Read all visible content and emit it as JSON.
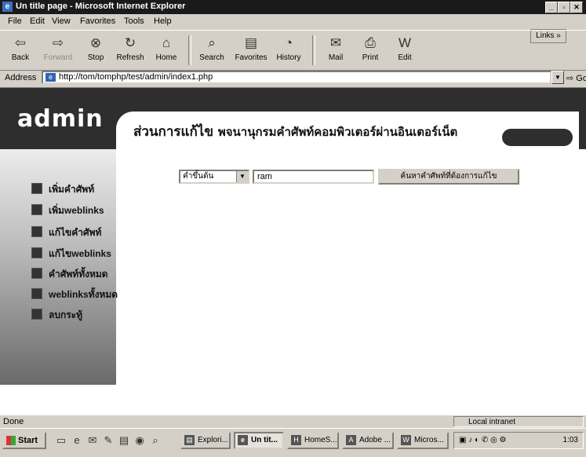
{
  "window": {
    "title": "Un title page - Microsoft Internet Explorer"
  },
  "menu": [
    "File",
    "Edit",
    "View",
    "Favorites",
    "Tools",
    "Help"
  ],
  "links_label": "Links »",
  "toolbar": {
    "back": "Back",
    "forward": "Forward",
    "stop": "Stop",
    "refresh": "Refresh",
    "home": "Home",
    "search": "Search",
    "favorites": "Favorites",
    "history": "History",
    "mail": "Mail",
    "print": "Print",
    "edit": "Edit"
  },
  "address": {
    "label": "Address",
    "url": "http://tom/tomphp/test/admin/index1.php",
    "go": "Go"
  },
  "page": {
    "brand": "admin",
    "heading_part1": "ส่วนการแก้ไข",
    "heading_part2": "พจนานุกรมคำศัพท์คอมพิวเตอร์ผ่านอินเตอร์เน็ต",
    "nav": [
      "เพิ่มคำศัพท์",
      "เพิ่มweblinks",
      "แก้ไขคำศัพท์",
      "แก้ไขweblinks",
      "คำศัพท์ทั้งหมด",
      "weblinksทั้งหมด",
      "ลบกระทู้"
    ],
    "search": {
      "select_value": "คำขึ้นต้น",
      "input_value": "ram",
      "button": "ค้นหาคำศัพท์ที่ต้องการแก้ไข"
    }
  },
  "status": {
    "text": "Done",
    "zone": "Local intranet"
  },
  "taskbar": {
    "start": "Start",
    "tasks": [
      "Explori...",
      "Un tit...",
      "HomeS...",
      "Adobe ...",
      "Micros..."
    ],
    "clock": "1:03"
  }
}
